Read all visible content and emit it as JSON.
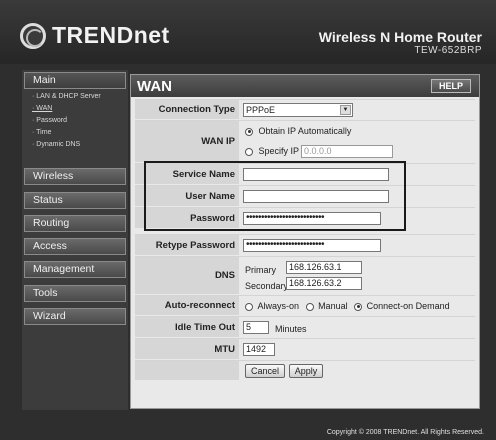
{
  "header": {
    "brand": "TRENDnet",
    "product_title": "Wireless N Home Router",
    "product_model": "TEW-652BRP"
  },
  "sidebar": {
    "main": "Main",
    "sub_items": [
      {
        "label": "· LAN & DHCP Server"
      },
      {
        "label": "· WAN"
      },
      {
        "label": "· Password"
      },
      {
        "label": "· Time"
      },
      {
        "label": "· Dynamic DNS"
      }
    ],
    "menus": [
      {
        "label": "Wireless"
      },
      {
        "label": "Status"
      },
      {
        "label": "Routing"
      },
      {
        "label": "Access"
      },
      {
        "label": "Management"
      },
      {
        "label": "Tools"
      },
      {
        "label": "Wizard"
      }
    ]
  },
  "panel": {
    "title": "WAN",
    "help": "HELP",
    "connection_type": {
      "label": "Connection Type",
      "value": "PPPoE"
    },
    "wan_ip": {
      "label": "WAN IP",
      "obtain": "Obtain IP Automatically",
      "specify": "Specify IP",
      "specify_value": "0.0.0.0"
    },
    "service_name": {
      "label": "Service Name",
      "value": ""
    },
    "user_name": {
      "label": "User Name",
      "value": ""
    },
    "password": {
      "label": "Password",
      "value": "••••••••••••••••••••••••••"
    },
    "retype_password": {
      "label": "Retype Password",
      "value": "••••••••••••••••••••••••••"
    },
    "dns": {
      "label": "DNS",
      "primary_label": "Primary",
      "primary_value": "168.126.63.1",
      "secondary_label": "Secondary",
      "secondary_value": "168.126.63.2"
    },
    "auto_reconnect": {
      "label": "Auto-reconnect",
      "always_on": "Always-on",
      "manual": "Manual",
      "on_demand": "Connect-on Demand"
    },
    "idle_time_out": {
      "label": "Idle Time Out",
      "value": "5",
      "unit": "Minutes"
    },
    "mtu": {
      "label": "MTU",
      "value": "1492"
    },
    "buttons": {
      "cancel": "Cancel",
      "apply": "Apply"
    }
  },
  "footer": "Copyright © 2008 TRENDnet. All Rights Reserved."
}
